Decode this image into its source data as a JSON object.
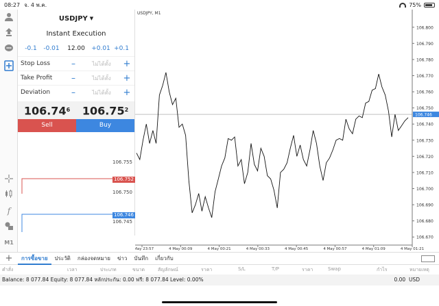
{
  "status": {
    "time": "08:27",
    "date": "จ. 4 พ.ค.",
    "battery": "75%"
  },
  "trade": {
    "symbol": "USDJPY",
    "execution": "Instant Execution",
    "vol_minus": [
      "-0.1",
      "-0.01"
    ],
    "volume": "12.00",
    "vol_plus": [
      "+0.01",
      "+0.1"
    ],
    "params": [
      {
        "label": "Stop Loss",
        "value": "ไม่ได้ตั้ง"
      },
      {
        "label": "Take Profit",
        "value": "ไม่ได้ตั้ง"
      },
      {
        "label": "Deviation",
        "value": "ไม่ได้ตั้ง"
      }
    ],
    "sell_price_main": "106.74",
    "sell_price_sup": "6",
    "buy_price_main": "106.75",
    "buy_price_sup": "2",
    "sell_label": "Sell",
    "buy_label": "Buy",
    "colors": {
      "sell": "#d9534f",
      "buy": "#3d87e0"
    }
  },
  "mini_chart": {
    "labels": [
      "106.755",
      "106.750",
      "106.745"
    ],
    "ask_tag": "106.752",
    "bid_tag": "106.746"
  },
  "left_icons": [
    "user-icon",
    "signal-icon",
    "chat-icon",
    "new-order-icon",
    "crosshair-icon",
    "candles-icon",
    "function-icon",
    "objects-icon",
    "timeframe-icon"
  ],
  "timeframe": "M1",
  "chart_data": {
    "type": "line",
    "title": "USDJPY, M1",
    "y_ticks": [
      "106.800",
      "106.790",
      "106.780",
      "106.770",
      "106.760",
      "106.750",
      "106.740",
      "106.730",
      "106.720",
      "106.710",
      "106.700",
      "106.690",
      "106.680",
      "106.670"
    ],
    "ylim": [
      106.665,
      106.805
    ],
    "current_price": "106.746",
    "current_value": 106.746,
    "x_ticks": [
      "3 May 23:57",
      "4 May 00:09",
      "4 May 00:21",
      "4 May 00:33",
      "4 May 00:45",
      "4 May 00:57",
      "4 May 01:09",
      "4 May 01:21"
    ],
    "values": [
      106.722,
      106.718,
      106.73,
      106.74,
      106.728,
      106.736,
      106.728,
      106.758,
      106.764,
      106.772,
      106.76,
      106.752,
      106.756,
      106.738,
      106.74,
      106.733,
      106.705,
      106.685,
      106.69,
      106.697,
      106.686,
      106.695,
      106.688,
      106.682,
      106.698,
      106.706,
      106.714,
      106.719,
      106.731,
      106.73,
      106.732,
      106.714,
      106.718,
      106.703,
      106.71,
      106.728,
      106.715,
      106.711,
      106.725,
      106.72,
      106.708,
      106.706,
      106.699,
      106.688,
      106.71,
      106.712,
      106.716,
      106.725,
      106.733,
      106.72,
      106.727,
      106.718,
      106.714,
      106.724,
      106.736,
      106.728,
      106.714,
      106.705,
      106.716,
      106.719,
      106.724,
      106.73,
      106.731,
      106.73,
      106.743,
      106.737,
      106.734,
      106.743,
      106.745,
      106.744,
      106.753,
      106.754,
      106.761,
      106.762,
      106.771,
      106.763,
      106.758,
      106.748,
      106.732,
      106.746,
      106.736,
      106.739,
      106.742,
      106.744
    ]
  },
  "tabs": [
    "การซื้อขาย",
    "ประวัติ",
    "กล่องจดหมาย",
    "ข่าว",
    "บันทึก",
    "เกี่ยวกับ"
  ],
  "columns": [
    "คำสั่ง",
    "เวลา",
    "ประเภท",
    "ขนาด",
    "สัญลักษณ์",
    "ราคา",
    "S/L",
    "T/P",
    "ราคา",
    "Swap",
    "กำไร",
    "หมายเหตุ"
  ],
  "balance": {
    "text": "Balance: 8 077.84 Equity: 8 077.84 หลักประกัน: 0.00 ฟรี: 8 077.84 Level: 0.00%",
    "profit": "0.00",
    "currency": "USD"
  }
}
